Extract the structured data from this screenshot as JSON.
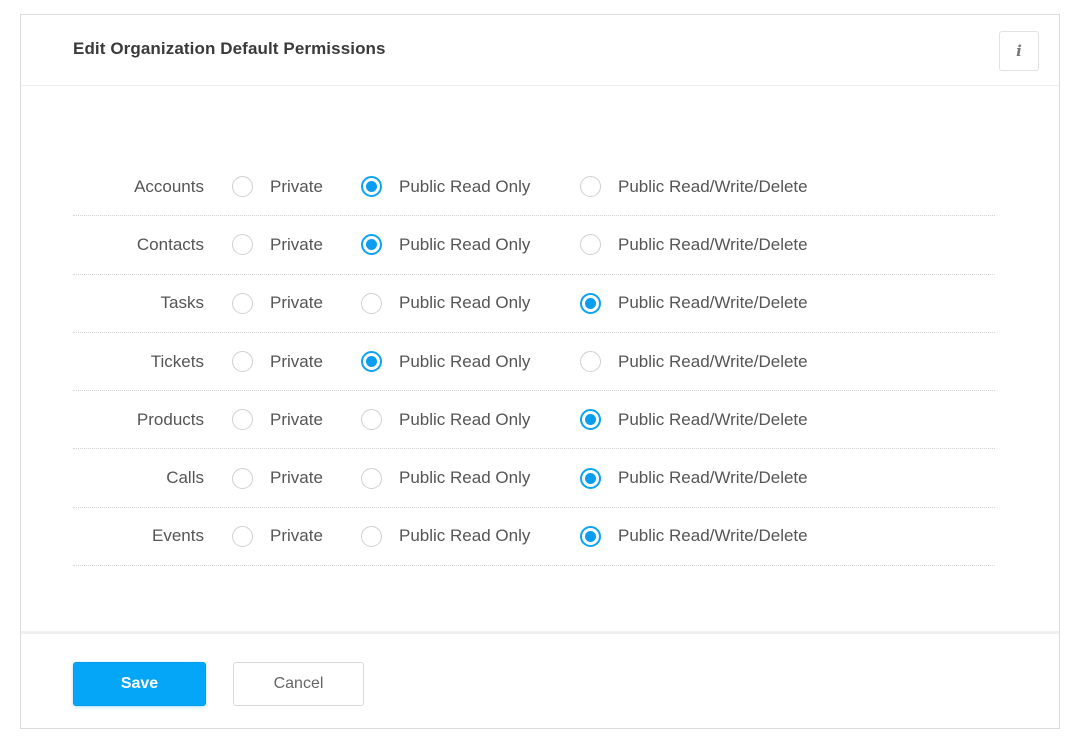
{
  "dialog": {
    "title": "Edit Organization Default Permissions",
    "info_icon": "i"
  },
  "options": [
    "Private",
    "Public Read Only",
    "Public Read/Write/Delete"
  ],
  "rows": [
    {
      "label": "Accounts",
      "selected": "Public Read Only"
    },
    {
      "label": "Contacts",
      "selected": "Public Read Only"
    },
    {
      "label": "Tasks",
      "selected": "Public Read/Write/Delete"
    },
    {
      "label": "Tickets",
      "selected": "Public Read Only"
    },
    {
      "label": "Products",
      "selected": "Public Read/Write/Delete"
    },
    {
      "label": "Calls",
      "selected": "Public Read/Write/Delete"
    },
    {
      "label": "Events",
      "selected": "Public Read/Write/Delete"
    }
  ],
  "footer": {
    "save_label": "Save",
    "cancel_label": "Cancel"
  },
  "colors": {
    "accent": "#05a6f8",
    "radio_checked": "#0a9df0"
  }
}
